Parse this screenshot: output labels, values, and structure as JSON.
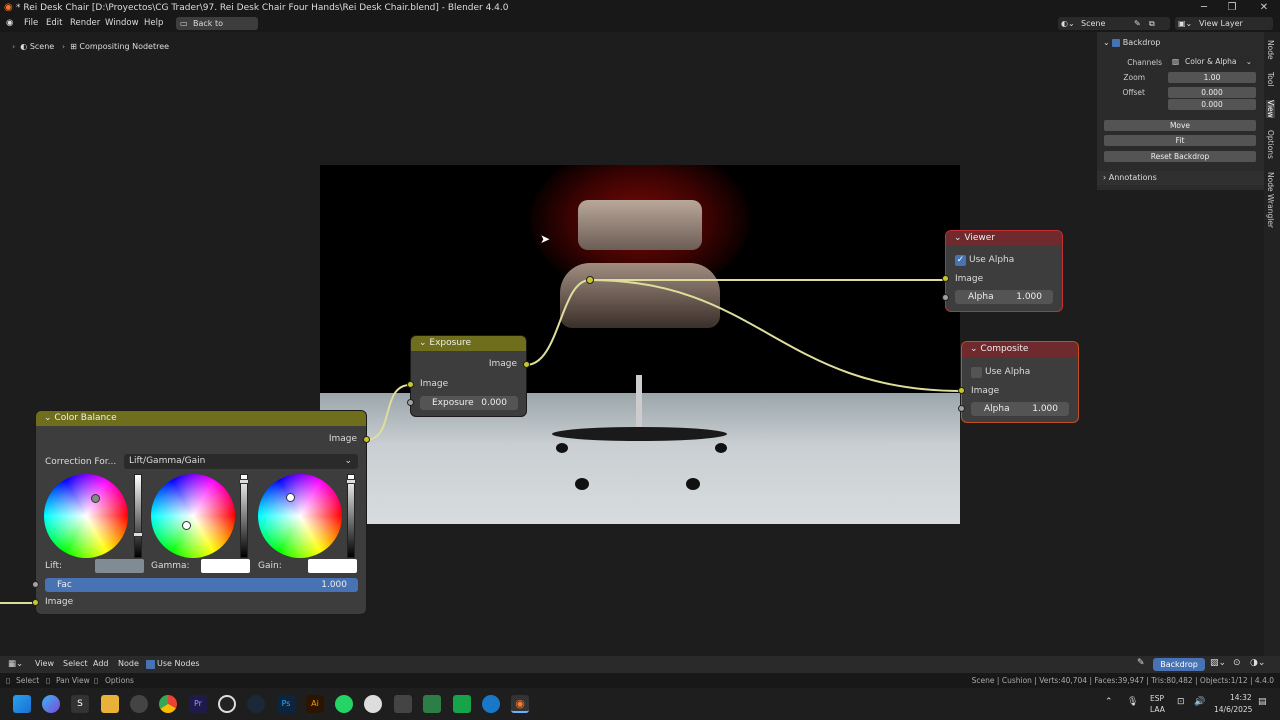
{
  "window": {
    "title": "* Rei Desk Chair [D:\\Proyectos\\CG Trader\\97. Rei Desk Chair Four Hands\\Rei Desk Chair.blend] - Blender 4.4.0"
  },
  "menu": {
    "file": "File",
    "edit": "Edit",
    "render": "Render",
    "window": "Window",
    "help": "Help",
    "back": "Back to Previous",
    "scene": "Scene",
    "view_layer": "View Layer"
  },
  "breadcrumb": {
    "scene": "Scene",
    "tree": "Compositing Nodetree"
  },
  "npanel": {
    "backdrop": "Backdrop",
    "channels_label": "Channels",
    "channels_value": "Color & Alpha",
    "zoom_label": "Zoom",
    "zoom_value": "1.00",
    "offset_label": "Offset",
    "offset_x": "0.000",
    "offset_y": "0.000",
    "move": "Move",
    "fit": "Fit",
    "reset": "Reset Backdrop",
    "annotations": "Annotations"
  },
  "vtabs": [
    "Node",
    "Tool",
    "View",
    "Options",
    "Node Wrangler"
  ],
  "nodes": {
    "viewer": {
      "title": "Viewer",
      "use_alpha": "Use Alpha",
      "image": "Image",
      "alpha_label": "Alpha",
      "alpha_value": "1.000"
    },
    "composite": {
      "title": "Composite",
      "use_alpha": "Use Alpha",
      "image": "Image",
      "alpha_label": "Alpha",
      "alpha_value": "1.000"
    },
    "exposure": {
      "title": "Exposure",
      "out_image": "Image",
      "in_image": "Image",
      "exposure_label": "Exposure",
      "exposure_value": "0.000"
    },
    "color_balance": {
      "title": "Color Balance",
      "out_image": "Image",
      "correction_label": "Correction For...",
      "correction_value": "Lift/Gamma/Gain",
      "lift": "Lift:",
      "gamma": "Gamma:",
      "gain": "Gain:",
      "fac_label": "Fac",
      "fac_value": "1.000",
      "in_image": "Image"
    }
  },
  "footer": {
    "view": "View",
    "select": "Select",
    "add": "Add",
    "node": "Node",
    "use_nodes": "Use Nodes",
    "backdrop": "Backdrop"
  },
  "status": {
    "select": "Select",
    "pan": "Pan View",
    "options": "Options",
    "stats": "Scene | Cushion | Verts:40,704 | Faces:39,947 | Tris:80,482 | Objects:1/12 | 4.4.0"
  },
  "taskbar": {
    "lang1": "ESP",
    "lang2": "LAA",
    "time": "14:32",
    "date": "14/6/2025"
  },
  "colors": {
    "node_body": "#3d3d3d",
    "output_header": "#6f2a2e",
    "color_header": "#6e6e1d",
    "socket_image": "#c7c729",
    "accent": "#4772b3"
  }
}
